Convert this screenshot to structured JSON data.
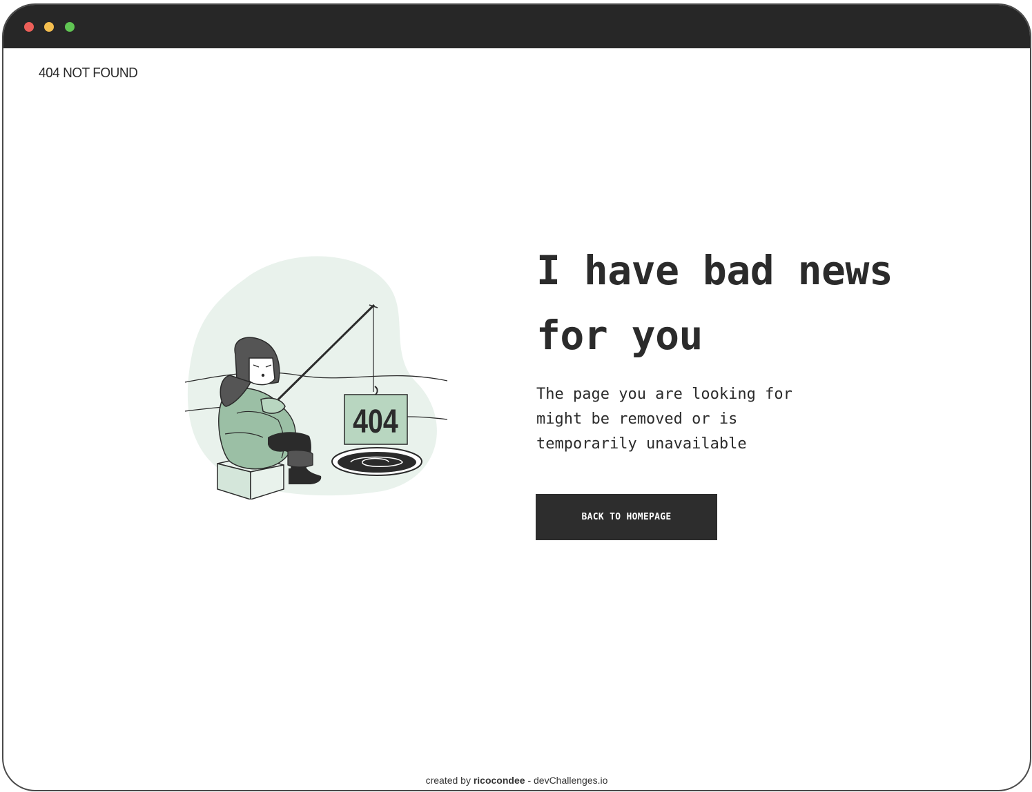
{
  "brand": {
    "title": "404 NOT FOUND"
  },
  "illustration": {
    "sign_text": "404",
    "icon": "ice-fishing-illustration"
  },
  "content": {
    "headline": "I have bad news for you",
    "description": "The page you are looking for might be removed or is temporarily unavailable",
    "button_label": "BACK TO HOMEPAGE"
  },
  "footer": {
    "prefix": "created by",
    "author": "ricocondee",
    "separator": "-",
    "site": "devChallenges.io"
  },
  "colors": {
    "titlebar": "#272727",
    "button_bg": "#2d2d2d",
    "text": "#2b2b2b",
    "accent_green": "#b8d6c0",
    "blob": "#e9f2ec",
    "close_dot": "#ec5f59",
    "minimize_dot": "#f4be4f",
    "maximize_dot": "#60c553"
  }
}
